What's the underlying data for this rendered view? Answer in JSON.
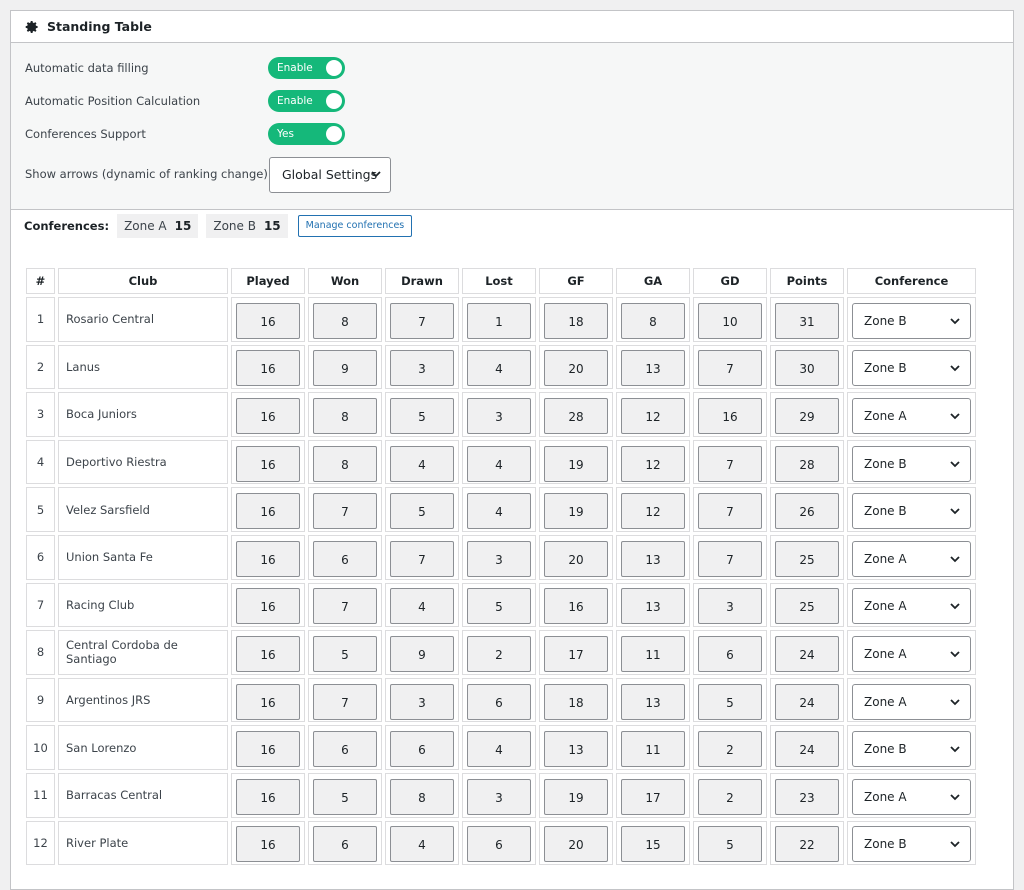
{
  "panel": {
    "title": "Standing Table",
    "icon": "gear-icon"
  },
  "settings": {
    "auto_fill": {
      "label": "Automatic data filling",
      "toggle": "Enable"
    },
    "auto_position": {
      "label": "Automatic Position Calculation",
      "toggle": "Enable"
    },
    "conferences_support": {
      "label": "Conferences Support",
      "toggle": "Yes"
    },
    "show_arrows": {
      "label": "Show arrows (dynamic of ranking change)",
      "value": "Global Settings"
    }
  },
  "conferences": {
    "label": "Conferences:",
    "chips": [
      {
        "name": "Zone A",
        "count": "15"
      },
      {
        "name": "Zone B",
        "count": "15"
      }
    ],
    "manage_label": "Manage conferences"
  },
  "table": {
    "headers": [
      "#",
      "Club",
      "Played",
      "Won",
      "Drawn",
      "Lost",
      "GF",
      "GA",
      "GD",
      "Points",
      "Conference"
    ],
    "rows": [
      {
        "pos": "1",
        "club": "Rosario Central",
        "played": "16",
        "won": "8",
        "drawn": "7",
        "lost": "1",
        "gf": "18",
        "ga": "8",
        "gd": "10",
        "points": "31",
        "conference": "Zone B"
      },
      {
        "pos": "2",
        "club": "Lanus",
        "played": "16",
        "won": "9",
        "drawn": "3",
        "lost": "4",
        "gf": "20",
        "ga": "13",
        "gd": "7",
        "points": "30",
        "conference": "Zone B"
      },
      {
        "pos": "3",
        "club": "Boca Juniors",
        "played": "16",
        "won": "8",
        "drawn": "5",
        "lost": "3",
        "gf": "28",
        "ga": "12",
        "gd": "16",
        "points": "29",
        "conference": "Zone A"
      },
      {
        "pos": "4",
        "club": "Deportivo Riestra",
        "played": "16",
        "won": "8",
        "drawn": "4",
        "lost": "4",
        "gf": "19",
        "ga": "12",
        "gd": "7",
        "points": "28",
        "conference": "Zone B"
      },
      {
        "pos": "5",
        "club": "Velez Sarsfield",
        "played": "16",
        "won": "7",
        "drawn": "5",
        "lost": "4",
        "gf": "19",
        "ga": "12",
        "gd": "7",
        "points": "26",
        "conference": "Zone B"
      },
      {
        "pos": "6",
        "club": "Union Santa Fe",
        "played": "16",
        "won": "6",
        "drawn": "7",
        "lost": "3",
        "gf": "20",
        "ga": "13",
        "gd": "7",
        "points": "25",
        "conference": "Zone A"
      },
      {
        "pos": "7",
        "club": "Racing Club",
        "played": "16",
        "won": "7",
        "drawn": "4",
        "lost": "5",
        "gf": "16",
        "ga": "13",
        "gd": "3",
        "points": "25",
        "conference": "Zone A"
      },
      {
        "pos": "8",
        "club": "Central Cordoba de Santiago",
        "played": "16",
        "won": "5",
        "drawn": "9",
        "lost": "2",
        "gf": "17",
        "ga": "11",
        "gd": "6",
        "points": "24",
        "conference": "Zone A"
      },
      {
        "pos": "9",
        "club": "Argentinos JRS",
        "played": "16",
        "won": "7",
        "drawn": "3",
        "lost": "6",
        "gf": "18",
        "ga": "13",
        "gd": "5",
        "points": "24",
        "conference": "Zone A"
      },
      {
        "pos": "10",
        "club": "San Lorenzo",
        "played": "16",
        "won": "6",
        "drawn": "6",
        "lost": "4",
        "gf": "13",
        "ga": "11",
        "gd": "2",
        "points": "24",
        "conference": "Zone B"
      },
      {
        "pos": "11",
        "club": "Barracas Central",
        "played": "16",
        "won": "5",
        "drawn": "8",
        "lost": "3",
        "gf": "19",
        "ga": "17",
        "gd": "2",
        "points": "23",
        "conference": "Zone A"
      },
      {
        "pos": "12",
        "club": "River Plate",
        "played": "16",
        "won": "6",
        "drawn": "4",
        "lost": "6",
        "gf": "20",
        "ga": "15",
        "gd": "5",
        "points": "22",
        "conference": "Zone B"
      }
    ]
  },
  "colors": {
    "toggle_on": "#15b87a",
    "link": "#2271b1",
    "border": "#c3c4c7"
  }
}
